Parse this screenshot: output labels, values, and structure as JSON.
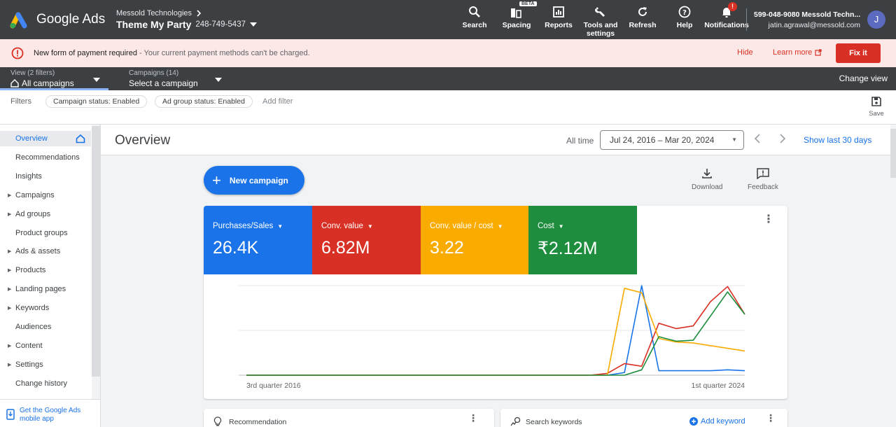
{
  "header": {
    "brand": "Google Ads",
    "account_org": "Messold Technologies",
    "account_name": "Theme My Party",
    "account_id": "248-749-5437",
    "tools": [
      {
        "label": "Search",
        "icon": "search-icon"
      },
      {
        "label": "Spacing",
        "icon": "spacing-icon",
        "badge": "BETA"
      },
      {
        "label": "Reports",
        "icon": "reports-icon"
      },
      {
        "label": "Tools and settings",
        "icon": "wrench-icon"
      },
      {
        "label": "Refresh",
        "icon": "refresh-icon"
      },
      {
        "label": "Help",
        "icon": "help-icon"
      },
      {
        "label": "Notifications",
        "icon": "bell-icon",
        "badge": "!"
      }
    ],
    "user_phone": "599-048-9080 Messold Techn...",
    "user_email": "jatin.agrawal@messold.com",
    "avatar_letter": "J"
  },
  "alert": {
    "title": "New form of payment required",
    "message": " - Your current payment methods can't be charged.",
    "hide": "Hide",
    "learn_more": "Learn more",
    "fix": "Fix it"
  },
  "campaign_bar": {
    "view_small": "View (2 filters)",
    "view_main": "All campaigns",
    "campaigns_small": "Campaigns (14)",
    "campaigns_main": "Select a campaign",
    "change_view": "Change view"
  },
  "filters": {
    "label": "Filters",
    "chips": [
      "Campaign status: Enabled",
      "Ad group status: Enabled"
    ],
    "add": "Add filter",
    "save": "Save"
  },
  "sidebar": {
    "items": [
      {
        "label": "Overview",
        "caret": false,
        "active": true
      },
      {
        "label": "Recommendations",
        "caret": false
      },
      {
        "label": "Insights",
        "caret": false
      },
      {
        "label": "Campaigns",
        "caret": true
      },
      {
        "label": "Ad groups",
        "caret": true
      },
      {
        "label": "Product groups",
        "caret": false
      },
      {
        "label": "Ads & assets",
        "caret": true
      },
      {
        "label": "Products",
        "caret": true
      },
      {
        "label": "Landing pages",
        "caret": true
      },
      {
        "label": "Keywords",
        "caret": true
      },
      {
        "label": "Audiences",
        "caret": false
      },
      {
        "label": "Content",
        "caret": true
      },
      {
        "label": "Settings",
        "caret": true
      },
      {
        "label": "Change history",
        "caret": false
      }
    ],
    "mobile_app": "Get the Google Ads mobile app"
  },
  "main": {
    "title": "Overview",
    "all_time": "All time",
    "date_range": "Jul 24, 2016 – Mar 20, 2024",
    "show_last": "Show last 30 days",
    "new_campaign": "New campaign",
    "download": "Download",
    "feedback": "Feedback"
  },
  "metrics": [
    {
      "label": "Purchases/Sales",
      "value": "26.4K",
      "color": "#1a73e8"
    },
    {
      "label": "Conv. value",
      "value": "6.82M",
      "color": "#d93025"
    },
    {
      "label": "Conv. value / cost",
      "value": "3.22",
      "color": "#f9ab00"
    },
    {
      "label": "Cost",
      "value": "₹2.12M",
      "color": "#1e8e3e"
    }
  ],
  "chart_data": {
    "type": "line",
    "x_labels": [
      "3rd quarter 2016",
      "1st quarter 2024"
    ],
    "grid": true,
    "series": [
      {
        "name": "Purchases/Sales",
        "color": "#1a73e8",
        "values": [
          0,
          0,
          0,
          0,
          0,
          0,
          0,
          0,
          0,
          0,
          0,
          0,
          0,
          0,
          0,
          0,
          0,
          0,
          0,
          0,
          0,
          0,
          0.03,
          1.0,
          0.05,
          0.05,
          0.05,
          0.05,
          0.06,
          0.05
        ]
      },
      {
        "name": "Conv. value",
        "color": "#d93025",
        "values": [
          0,
          0,
          0,
          0,
          0,
          0,
          0,
          0,
          0,
          0,
          0,
          0,
          0,
          0,
          0,
          0,
          0,
          0,
          0,
          0,
          0,
          0.02,
          0.13,
          0.1,
          0.58,
          0.52,
          0.55,
          0.82,
          0.99,
          0.68
        ]
      },
      {
        "name": "Conv. value / cost",
        "color": "#f9ab00",
        "values": [
          0,
          0,
          0,
          0,
          0,
          0,
          0,
          0,
          0,
          0,
          0,
          0,
          0,
          0,
          0,
          0,
          0,
          0,
          0,
          0,
          0,
          0,
          0.97,
          0.92,
          0.41,
          0.37,
          0.36,
          0.33,
          0.3,
          0.27
        ]
      },
      {
        "name": "Cost",
        "color": "#1e8e3e",
        "values": [
          0,
          0,
          0,
          0,
          0,
          0,
          0,
          0,
          0,
          0,
          0,
          0,
          0,
          0,
          0,
          0,
          0,
          0,
          0,
          0,
          0,
          0,
          0,
          0.06,
          0.43,
          0.38,
          0.39,
          0.66,
          0.93,
          0.68
        ]
      }
    ]
  },
  "bottom_cards": {
    "recommendation": "Recommendation",
    "search_keywords": "Search keywords",
    "add_keyword": "Add keyword"
  }
}
